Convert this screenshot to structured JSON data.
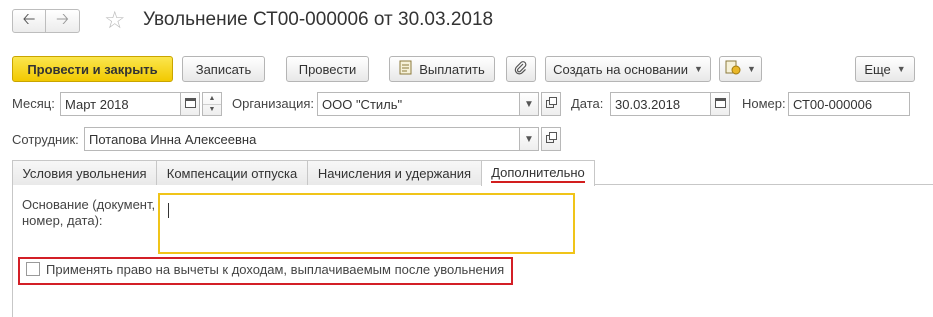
{
  "header": {
    "back_icon": "arrow-left-icon",
    "forward_icon": "arrow-right-icon",
    "favorite_icon": "star-icon",
    "title": "Увольнение СТ00-000006 от 30.03.2018"
  },
  "toolbar": {
    "post_close": "Провести и закрыть",
    "save": "Записать",
    "post": "Провести",
    "pay": "Выплатить",
    "create_based": "Создать на основании",
    "more": "Еще"
  },
  "form": {
    "month_label": "Месяц:",
    "month_value": "Март 2018",
    "org_label": "Организация:",
    "org_value": "ООО \"Стиль\"",
    "date_label": "Дата:",
    "date_value": "30.03.2018",
    "number_label": "Номер:",
    "number_value": "СТ00-000006",
    "employee_label": "Сотрудник:",
    "employee_value": "Потапова Инна Алексеевна"
  },
  "tabs": [
    {
      "label": "Условия увольнения"
    },
    {
      "label": "Компенсации отпуска"
    },
    {
      "label": "Начисления и удержания"
    },
    {
      "label": "Дополнительно"
    }
  ],
  "panel": {
    "basis_label": "Основание (документ, номер, дата):",
    "basis_value": "",
    "checkbox_label": "Применять право на вычеты к доходам, выплачиваемым после увольнения",
    "checkbox_checked": false
  },
  "colors": {
    "primary_button": "#f2c900",
    "focus_border": "#f0c419",
    "highlight_border": "#d31f26",
    "active_tab_underline": "#d21e1e"
  }
}
